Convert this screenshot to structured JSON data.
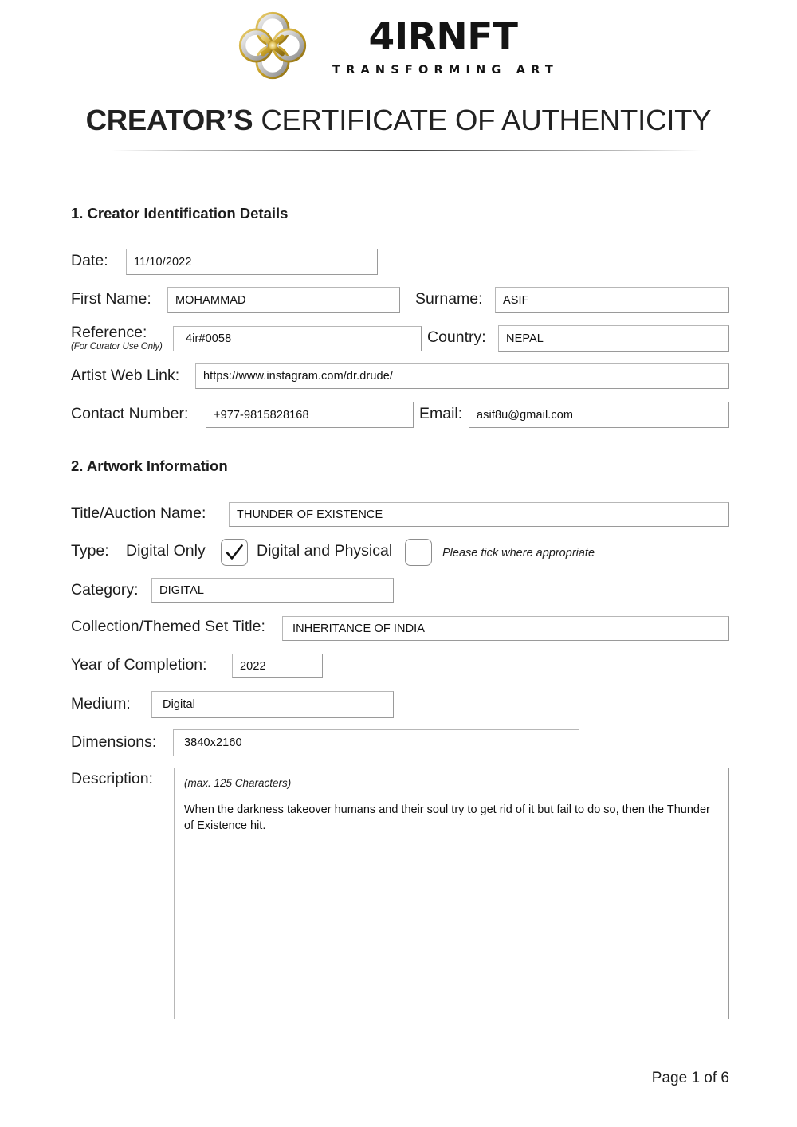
{
  "brand": {
    "name": "4IRNFT",
    "tagline": "TRANSFORMING ART",
    "logo_icon": "quatrefoil-knot-logo-icon",
    "gold": "#c9a227",
    "silver": "#c9c9c9"
  },
  "document": {
    "title_strong": "CREATOR’S",
    "title_rest": "CERTIFICATE OF AUTHENTICITY",
    "footer": "Page 1 of 6"
  },
  "section1": {
    "heading": "1. Creator Identification Details",
    "date": {
      "label": "Date:",
      "value": "11/10/2022"
    },
    "first_name": {
      "label": "First Name:",
      "value": "MOHAMMAD"
    },
    "surname": {
      "label": "Surname:",
      "value": "ASIF"
    },
    "reference": {
      "label": "Reference:",
      "sub_label": "(For Curator Use Only)",
      "value": "4ir#0058"
    },
    "country": {
      "label": "Country:",
      "value": "NEPAL"
    },
    "web_link": {
      "label": "Artist Web Link:",
      "value": "https://www.instagram.com/dr.drude/"
    },
    "contact": {
      "label": "Contact Number:",
      "value": "+977-9815828168"
    },
    "email": {
      "label": "Email:",
      "value": "asif8u@gmail.com"
    }
  },
  "section2": {
    "heading": "2. Artwork Information",
    "title_auction": {
      "label": "Title/Auction Name:",
      "value": "THUNDER  OF EXISTENCE"
    },
    "type": {
      "label": "Type:",
      "option_digital_only": "Digital Only",
      "option_digital_physical": "Digital and Physical",
      "digital_only_checked": true,
      "digital_physical_checked": false,
      "hint": "Please tick where appropriate"
    },
    "category": {
      "label": "Category:",
      "value": "DIGITAL"
    },
    "collection": {
      "label": "Collection/Themed  Set  Title:",
      "value": "INHERITANCE  OF INDIA"
    },
    "year": {
      "label": "Year of Completion:",
      "value": "2022"
    },
    "medium": {
      "label": "Medium:",
      "value": "Digital"
    },
    "dimensions": {
      "label": "Dimensions:",
      "value": "3840x2160"
    },
    "description": {
      "label": "Description:",
      "max_note": "(max. 125 Characters)",
      "value": "When the darkness takeover humans and their soul try to get rid of it but fail to do so, then the Thunder of Existence hit."
    }
  }
}
